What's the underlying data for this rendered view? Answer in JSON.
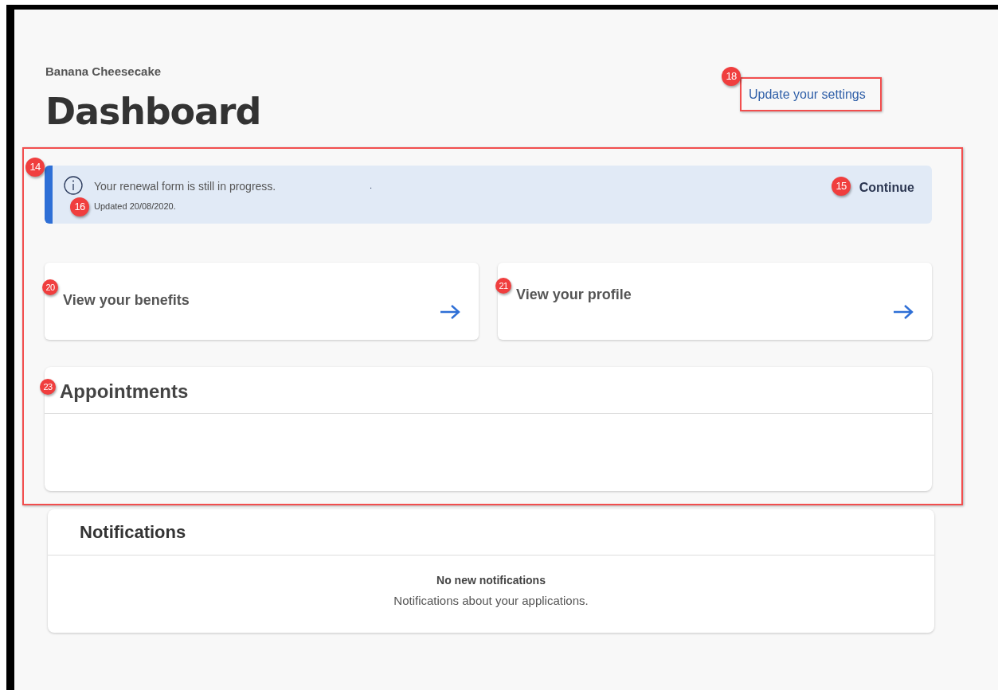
{
  "page": {
    "subtitle": "Banana Cheesecake",
    "title": "Dashboard",
    "settings_link": "Update your settings"
  },
  "banner": {
    "message": "Your renewal form is still in progress.",
    "stray_mark": ".",
    "updated": "Updated 20/08/2020.",
    "action": "Continue"
  },
  "cards": [
    {
      "title": "View your benefits"
    },
    {
      "title": "View your profile"
    }
  ],
  "appointments": {
    "title": "Appointments"
  },
  "notifications": {
    "title": "Notifications",
    "empty_title": "No new notifications",
    "empty_text": "Notifications about your applications."
  },
  "annotations": [
    {
      "number": "14"
    },
    {
      "number": "15"
    },
    {
      "number": "16"
    },
    {
      "number": "18"
    },
    {
      "number": "20"
    },
    {
      "number": "21"
    },
    {
      "number": "23"
    }
  ]
}
